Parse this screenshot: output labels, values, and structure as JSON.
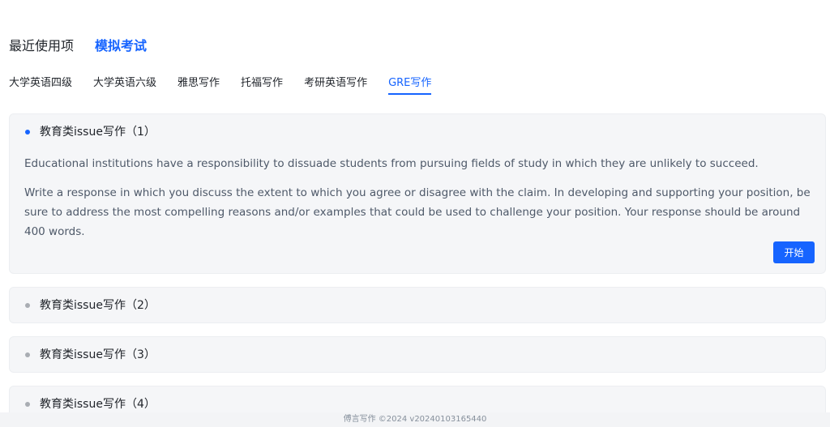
{
  "top_tabs": [
    {
      "label": "最近使用项"
    },
    {
      "label": "模拟考试"
    }
  ],
  "sub_tabs": [
    {
      "label": "大学英语四级"
    },
    {
      "label": "大学英语六级"
    },
    {
      "label": "雅思写作"
    },
    {
      "label": "托福写作"
    },
    {
      "label": "考研英语写作"
    },
    {
      "label": "GRE写作"
    }
  ],
  "tasks": [
    {
      "title": "教育类issue写作（1）",
      "prompt": "Educational institutions have a responsibility to dissuade students from pursuing fields of study in which they are unlikely to succeed.",
      "instructions": "Write a response in which you discuss the extent to which you agree or disagree with the claim. In developing and supporting your position, be sure to address the most compelling reasons and/or examples that could be used to challenge your position. Your response should be around 400 words.",
      "start_label": "开始"
    },
    {
      "title": "教育类issue写作（2）"
    },
    {
      "title": "教育类issue写作（3）"
    },
    {
      "title": "教育类issue写作（4）"
    }
  ],
  "footer": {
    "text": "傅言写作 ©2024 v20240103165440"
  },
  "colors": {
    "accent": "#1664ff",
    "card_bg": "#f5f6f8",
    "muted_dot": "#a9adb3"
  }
}
